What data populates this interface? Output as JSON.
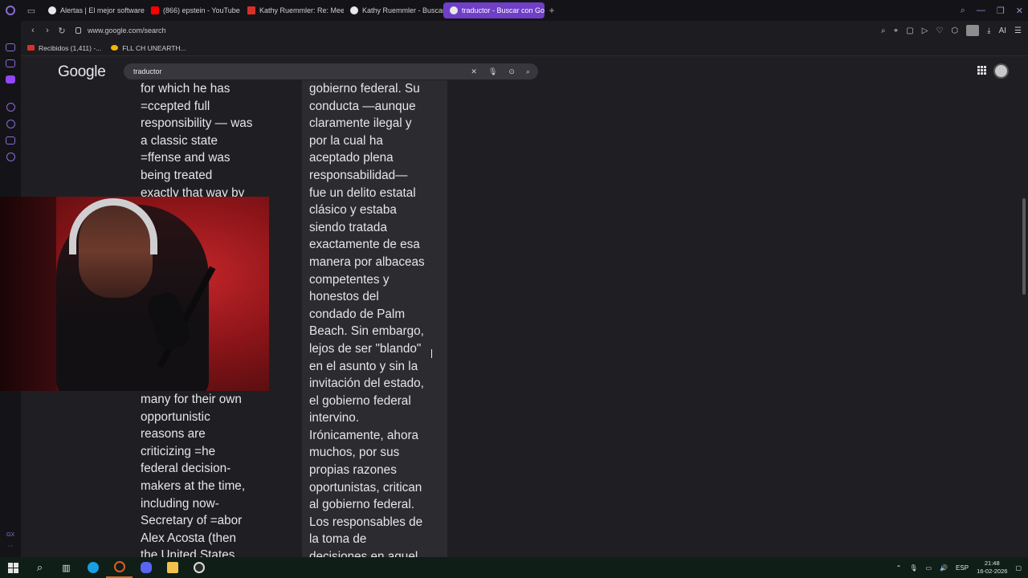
{
  "browser": {
    "tabs": [
      {
        "label": "Alertas | El mejor software",
        "color": "#e8e8e8"
      },
      {
        "label": "(866) epstein - YouTube",
        "color": "#ff0000"
      },
      {
        "label": "Kathy Ruemmler: Re: Mee",
        "color": "#d93025"
      },
      {
        "label": "Kathy Ruemmler - Buscar",
        "color": "#e8e8e8"
      },
      {
        "label": "traductor - Buscar con Go",
        "color": "#e8e8e8"
      }
    ],
    "active_tab_index": 4,
    "url": "www.google.com/search",
    "ai_label": "AI",
    "accent_color": "#6f3fc8"
  },
  "bookmarks": [
    {
      "label": "Recibidos (1,411) -...",
      "color": "#d93025"
    },
    {
      "label": "FLL CH UNEARTH...",
      "color": "#f4b400"
    }
  ],
  "sidebar": {
    "bottom_label": "GX"
  },
  "google": {
    "logo": "Google",
    "query": "traductor"
  },
  "source_text_top": "for which he has\n=ccepted full\nresponsibility — was\na classic state\n=ffense and was\nbeing treated\nexactly that way by",
  "source_text_bottom": "many for their own\nopportunistic\nreasons are\ncriticizing =he\nfederal decision-\nmakers at the time,\nincluding now-\nSecretary of =abor\nAlex Acosta (then\nthe United States",
  "translation_text": "gobierno federal. Su\nconducta —aunque\nclaramente ilegal y\npor la cual ha\naceptado plena\nresponsabilidad—\nfue un delito estatal\nclásico y estaba\nsiendo tratada\nexactamente de esa\nmanera por albaceas\ncompetentes y\nhonestos del\ncondado de Palm\nBeach. Sin embargo,\nlejos de ser \"blando\"\nen el asunto y sin la\ninvitación del estado,\nel gobierno federal\nintervino.\nIrónicamente, ahora\nmuchos, por sus\npropias razones\noportunistas, critican\nal gobierno federal.\nLos responsables de\nla toma de\ndecisiones en aquel",
  "taskbar": {
    "language": "ESP",
    "time": "21:48",
    "date": "16-02-2026"
  }
}
